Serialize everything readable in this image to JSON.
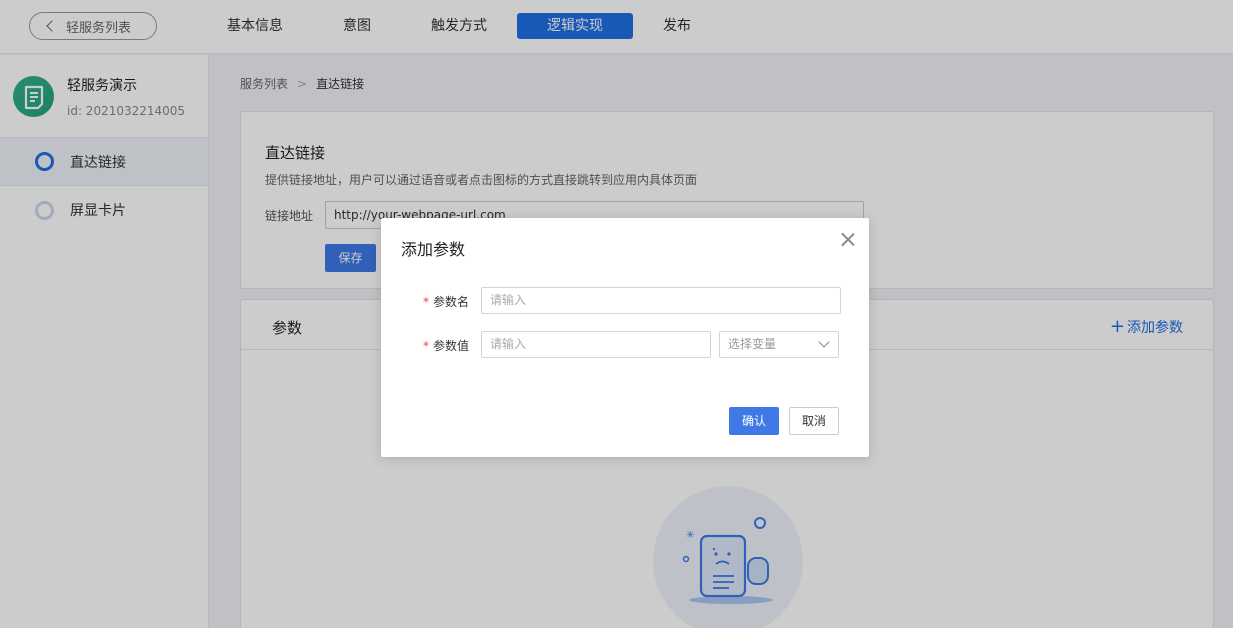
{
  "topbar": {
    "back_label": "轻服务列表",
    "tabs": [
      {
        "label": "基本信息"
      },
      {
        "label": "意图"
      },
      {
        "label": "触发方式"
      },
      {
        "label": "逻辑实现",
        "active": true
      },
      {
        "label": "发布"
      }
    ]
  },
  "sidebar": {
    "app_name": "轻服务演示",
    "app_id": "id: 2021032214005",
    "items": [
      {
        "label": "直达链接",
        "active": true
      },
      {
        "label": "屏显卡片",
        "active": false
      }
    ]
  },
  "breadcrumb": {
    "root": "服务列表",
    "separator": ">",
    "current": "直达链接"
  },
  "link_card": {
    "title": "直达链接",
    "description": "提供链接地址，用户可以通过语音或者点击图标的方式直接跳转到应用内具体页面",
    "url_label": "链接地址",
    "url_value": "http://your-webpage-url.com",
    "save_label": "保存"
  },
  "params_card": {
    "title": "参数",
    "add_label": "添加参数"
  },
  "modal": {
    "title": "添加参数",
    "name_label": "参数名",
    "name_placeholder": "请输入",
    "value_label": "参数值",
    "value_placeholder": "请输入",
    "variable_select": "选择变量",
    "required_mark": "*",
    "ok_label": "确认",
    "cancel_label": "取消"
  },
  "colors": {
    "accent": "#1f6fe5",
    "button": "#3e79e6",
    "logo": "#2fb38a",
    "required": "#ee4444"
  }
}
